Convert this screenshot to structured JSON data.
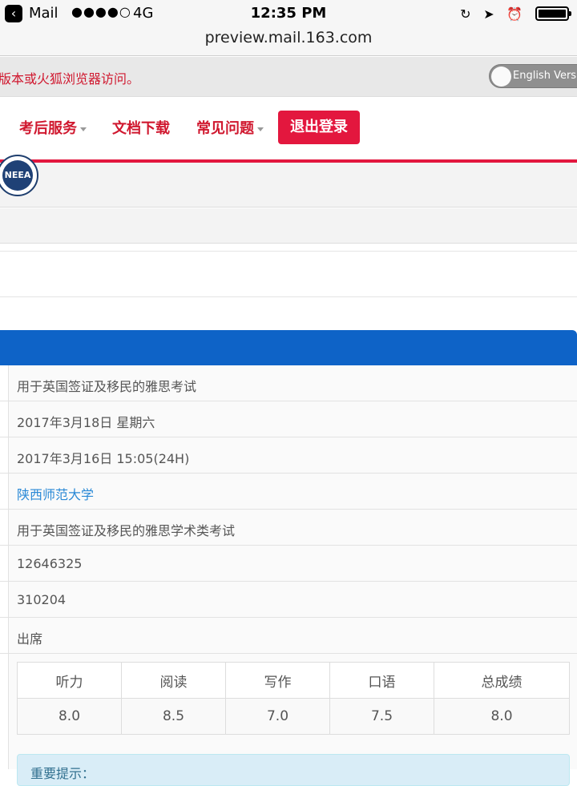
{
  "status_bar": {
    "back_app": "Mail",
    "signal": "●●●●○",
    "network": "4G",
    "time": "12:35 PM"
  },
  "browser": {
    "url": "preview.mail.163.com"
  },
  "notice": {
    "text": "版本或火狐浏览器访问。",
    "lang_toggle": "English Version"
  },
  "nav": {
    "items": [
      {
        "label": "考后服务",
        "dropdown": true
      },
      {
        "label": "文档下载",
        "dropdown": false
      },
      {
        "label": "常见问题",
        "dropdown": true
      }
    ],
    "logout": "退出登录"
  },
  "logo": {
    "text": "NEEA"
  },
  "colors": {
    "brand_red": "#e3173e",
    "header_blue": "#0e63c7",
    "link_blue": "#2a89d6"
  },
  "result_rows": [
    {
      "value": "用于英国签证及移民的雅思考试",
      "link": false
    },
    {
      "value": "2017年3月18日 星期六",
      "link": false
    },
    {
      "value": "2017年3月16日 15:05(24H)",
      "link": false
    },
    {
      "value": "陕西师范大学",
      "link": true
    },
    {
      "value": "用于英国签证及移民的雅思学术类考试",
      "link": false
    },
    {
      "value": "12646325",
      "link": false
    },
    {
      "value": "310204",
      "link": false
    },
    {
      "value": "出席",
      "link": false
    }
  ],
  "scores": {
    "headers": [
      "听力",
      "阅读",
      "写作",
      "口语",
      "总成绩"
    ],
    "values": [
      "8.0",
      "8.5",
      "7.0",
      "7.5",
      "8.0"
    ]
  },
  "tip": {
    "text": "重要提示："
  }
}
